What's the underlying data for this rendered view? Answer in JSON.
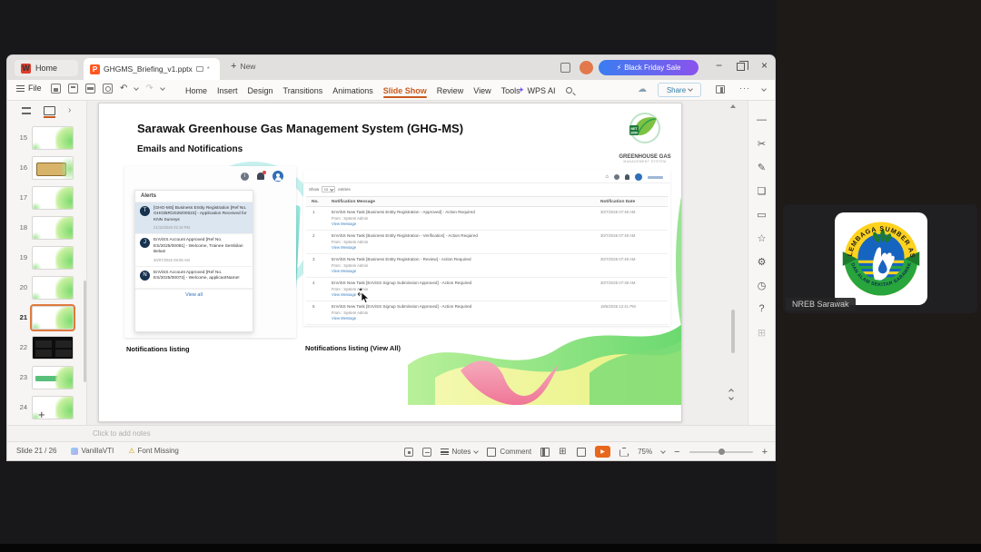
{
  "window": {
    "home_tab": "Home",
    "document_tab": "GHGMS_Briefing_v1.pptx",
    "new_tab_label": "New",
    "promo_label": "Black Friday Sale",
    "file_label": "File",
    "wps_ai_label": "WPS AI",
    "share_label": "Share",
    "menu_items": [
      {
        "label": "Home"
      },
      {
        "label": "Insert"
      },
      {
        "label": "Design"
      },
      {
        "label": "Transitions"
      },
      {
        "label": "Animations"
      },
      {
        "label": "Slide Show",
        "active": true
      },
      {
        "label": "Review"
      },
      {
        "label": "View"
      },
      {
        "label": "Tools"
      }
    ]
  },
  "slide_panel": {
    "items": [
      {
        "num": "15",
        "variant": "green"
      },
      {
        "num": "16",
        "variant": "tan"
      },
      {
        "num": "17",
        "variant": "green"
      },
      {
        "num": "18",
        "variant": "green"
      },
      {
        "num": "19",
        "variant": "green"
      },
      {
        "num": "20",
        "variant": "green"
      },
      {
        "num": "21",
        "variant": "green",
        "active": true
      },
      {
        "num": "22",
        "variant": "dark"
      },
      {
        "num": "23",
        "variant": "green2"
      },
      {
        "num": "24",
        "variant": "green"
      }
    ]
  },
  "slide": {
    "title": "Sarawak Greenhouse Gas Management System (GHG-MS)",
    "subtitle": "Emails and Notifications",
    "logo": {
      "badge_line1": "NET",
      "badge_line2": "2050",
      "name_line1": "GREENHOUSE GAS",
      "name_line2": "MANAGEMENT SYSTEM"
    },
    "alerts": {
      "header": "Alerts",
      "view_all": "View all",
      "items": [
        {
          "avatar": "T",
          "highlight": true,
          "text": "[GHG-MS] Business Entity Registration [Ref No. GHG/BR/2025/00023] - Application Received for KNN Surveys",
          "date": "21/10/2025 02:19 PM"
        },
        {
          "avatar": "J",
          "text": "EnViSS Account Approved [Ref No. ES/2025/00081] - Welcome, Trainee Sembilan Belas!",
          "date": "30/07/2025 08:09 AM"
        },
        {
          "avatar": "N",
          "text": "EnViSS Account Approved [Ref No. ES/2025/00072] - Welcome, applicantName!",
          "date": ""
        }
      ]
    },
    "table": {
      "show_label": "Show",
      "show_value": "10",
      "entries_label": "entries",
      "headers": [
        "No.",
        "Notification Message",
        "Notification Date"
      ],
      "rows": [
        {
          "no": "1",
          "message": "EnViSS New Task [Business Entity Registration - Approved] - Action Required",
          "from": "From : System Admin",
          "link": "View Message",
          "date": "30/7/2025 07:49 AM"
        },
        {
          "no": "2",
          "message": "EnViSS New Task [Business Entity Registration - Verification] - Action Required",
          "from": "From : System Admin",
          "link": "View Message",
          "date": "30/7/2025 07:49 AM"
        },
        {
          "no": "3",
          "message": "EnViSS New Task [Business Entity Registration - Review] - Action Required",
          "from": "From : System Admin",
          "link": "View Message",
          "date": "30/7/2025 07:49 AM"
        },
        {
          "no": "4",
          "message": "EnViSS New Task [EnViSS Signup Submission Approved] - Action Required",
          "from": "From : System Admin",
          "link": "View Message",
          "date": "30/7/2025 07:39 AM"
        },
        {
          "no": "5",
          "message": "EnViSS New Task [EnViSS Signup Submission Approved] - Action Required",
          "from": "From : System Admin",
          "link": "View Message",
          "date": "18/6/2025 12:41 PM"
        }
      ]
    },
    "captions": {
      "left": "Notifications listing",
      "right": "Notifications listing (View All)"
    }
  },
  "notes_placeholder": "Click to add notes",
  "status_bar": {
    "slide_indicator": "Slide 21 / 26",
    "theme_name": "VanillaVTI",
    "font_missing": "Font Missing",
    "notes_label": "Notes",
    "comment_label": "Comment",
    "zoom_level": "75%"
  },
  "meeting": {
    "participant_name": "NREB Sarawak",
    "logo_text_top": "LEMBAGA SUMBER ASLI",
    "logo_text_bottom": "DAN ALAM SEKITAR SARAWAK"
  },
  "icons": {
    "lightning": "⚡",
    "spark": "✦",
    "cloud": "☁",
    "undo": "↶",
    "redo": "↷",
    "warning": "⚠",
    "play": "▶",
    "close": "×",
    "min": "−",
    "more": "···",
    "panel_next": "›",
    "plus": "+",
    "home": "⌂",
    "sidebar": {
      "minimize": "—",
      "cut": "✂",
      "edit": "✎",
      "shapes": "❏",
      "comment": "▭",
      "star": "☆",
      "settings": "⚙",
      "history": "◷",
      "help": "?",
      "apps": "⊞"
    },
    "sorter_grid": "⊞"
  },
  "colors": {
    "menu_active": "#c85a1e",
    "promo_start": "#3a7df0",
    "promo_end": "#8a53ee",
    "play_button": "#e8671d",
    "alert_highlight": "#dce6f1",
    "link_blue": "#3b82c4",
    "thumb_selected_border": "#e07a3f"
  }
}
